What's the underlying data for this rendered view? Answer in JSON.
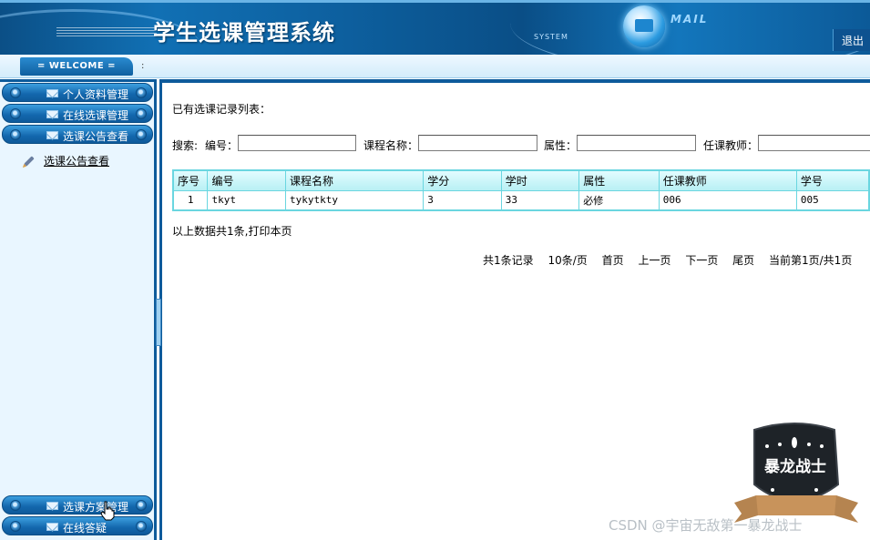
{
  "header": {
    "title": "学生选课管理系统",
    "system_label": "SYSTEM",
    "mail_label": "MAIL",
    "logout": "退出"
  },
  "welcome": {
    "tab": "= WELCOME =",
    "colon": ":"
  },
  "sidebar": {
    "items": [
      {
        "label": "个人资料管理"
      },
      {
        "label": "在线选课管理"
      },
      {
        "label": "选课公告查看"
      }
    ],
    "subitem": "选课公告查看",
    "bottom_items": [
      {
        "label": "选课方案管理"
      },
      {
        "label": "在线答疑"
      }
    ]
  },
  "main": {
    "list_title": "已有选课记录列表：",
    "search": {
      "prefix": "搜索:",
      "fields": [
        {
          "label": "编号：",
          "value": ""
        },
        {
          "label": "课程名称：",
          "value": ""
        },
        {
          "label": "属性：",
          "value": ""
        },
        {
          "label": "任课教师：",
          "value": ""
        }
      ]
    },
    "table": {
      "headers": [
        "序号",
        "编号",
        "课程名称",
        "学分",
        "学时",
        "属性",
        "任课教师",
        "学号"
      ],
      "rows": [
        [
          "1",
          "tkyt",
          "tykytkty",
          "3",
          "33",
          "必修",
          "006",
          "005"
        ]
      ]
    },
    "summary": "以上数据共1条,打印本页",
    "pager": {
      "total": "共1条记录",
      "per_page": "10条/页",
      "first": "首页",
      "prev": "上一页",
      "next": "下一页",
      "last": "尾页",
      "current": "当前第1页/共1页"
    }
  },
  "watermark": {
    "badge_text": "暴龙战士",
    "csdn": "CSDN @宇宙无敌第一暴龙战士"
  },
  "colors": {
    "header_blue": "#0d5f9e",
    "nav_blue": "#1367ad",
    "table_border": "#6ad6e0",
    "table_header_bg": "#c6f4f7",
    "sidebar_bg": "#e9f6ff"
  }
}
